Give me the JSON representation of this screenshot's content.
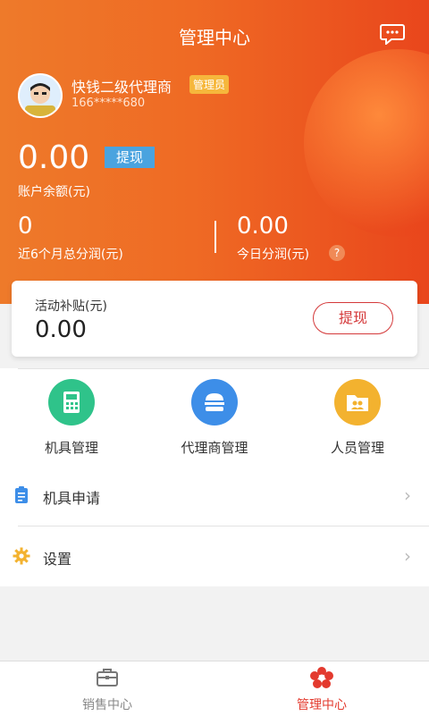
{
  "header": {
    "title": "管理中心",
    "message_icon": "message-icon"
  },
  "profile": {
    "name": "快钱二级代理商",
    "role_badge": "管理员",
    "phone": "166*****680",
    "avatar_icon": "avatar"
  },
  "balance": {
    "amount": "0.00",
    "withdraw_label": "提现",
    "label": "账户余额(元)"
  },
  "stats": [
    {
      "value": "0",
      "label": "近6个月总分润(元)"
    },
    {
      "value": "0.00",
      "label": "今日分润(元)",
      "help_icon": "question-icon",
      "help_text": "?"
    }
  ],
  "subsidy": {
    "label": "活动补贴(元)",
    "amount": "0.00",
    "withdraw_label": "提现"
  },
  "grid": [
    {
      "label": "机具管理",
      "icon": "pos-terminal-icon",
      "color": "#2fc38a"
    },
    {
      "label": "代理商管理",
      "icon": "agent-icon",
      "color": "#3d8ee8"
    },
    {
      "label": "人员管理",
      "icon": "staff-folder-icon",
      "color": "#f3b22f"
    }
  ],
  "list": [
    {
      "label": "机具申请",
      "icon": "clipboard-icon",
      "chevron": "›"
    },
    {
      "label": "设置",
      "icon": "gear-icon",
      "chevron": "›"
    }
  ],
  "tabs": [
    {
      "label": "销售中心",
      "icon": "briefcase-icon",
      "active": false
    },
    {
      "label": "管理中心",
      "icon": "flower-icon",
      "active": true
    }
  ],
  "colors": {
    "accent": "#e33a2e",
    "hero_start": "#ee7a2a",
    "hero_end": "#e9461c"
  }
}
